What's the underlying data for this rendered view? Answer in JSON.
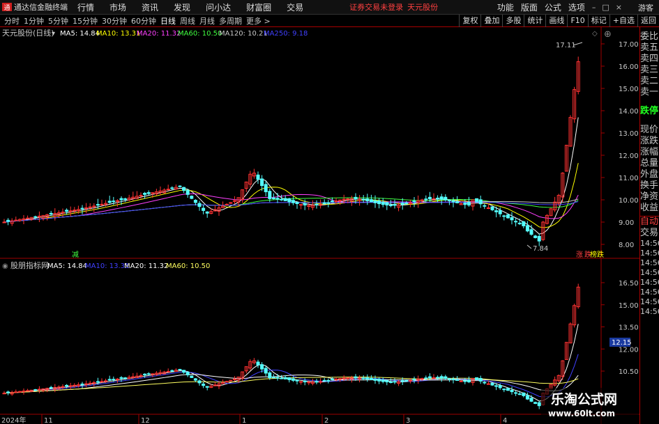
{
  "app": {
    "title": "通达信金融终端",
    "logo_glyph": "通",
    "menu": [
      "行情",
      "市场",
      "资讯",
      "发现",
      "问小达",
      "财富圈",
      "交易"
    ],
    "login_warning": "证券交易未登录",
    "top_stock_name": "天元股份",
    "right_menu": [
      "功能",
      "版面",
      "公式",
      "选项"
    ],
    "window_buttons": [
      "–",
      "□",
      "×"
    ],
    "guest": "游客"
  },
  "periods": {
    "tabs": [
      "分时",
      "1分钟",
      "5分钟",
      "15分钟",
      "30分钟",
      "60分钟",
      "日线",
      "周线",
      "月线",
      "多周期",
      "更多 >"
    ],
    "active": "日线"
  },
  "toolbar": [
    "复权",
    "叠加",
    "多股",
    "统计",
    "画线",
    "F10",
    "标记",
    "+自选",
    "返回"
  ],
  "upper_pane": {
    "stock_label": "天元股份(日线)",
    "ma_legend": [
      {
        "label": "MA5: 14.84",
        "color": "#ffffff"
      },
      {
        "label": "MA10: 13.31",
        "color": "#ffff00"
      },
      {
        "label": "MA20: 11.32",
        "color": "#ff40ff"
      },
      {
        "label": "MA60: 10.50",
        "color": "#40ff40"
      },
      {
        "label": "MA120: 10.21",
        "color": "#c8c8c8"
      },
      {
        "label": "MA250: 9.18",
        "color": "#4040ff"
      }
    ],
    "y_ticks": [
      "17.00",
      "16.00",
      "15.00",
      "14.00",
      "13.00",
      "12.00",
      "11.00",
      "10.00",
      "9.00",
      "8.00"
    ],
    "max_label": "17.11",
    "min_label": "7.84",
    "reduce_mark": "减",
    "limit_label_1": "涨",
    "limit_label_2": "跌",
    "limit_label_3": "榜跌"
  },
  "lower_pane": {
    "indicator_label": "股朋指标网",
    "ma_legend": [
      {
        "label": "MA5: 14.84",
        "color": "#ffffff"
      },
      {
        "label": "MA10: 13.31",
        "color": "#4040ff"
      },
      {
        "label": "MA20: 11.32",
        "color": "#ffffff"
      },
      {
        "label": "MA60: 10.50",
        "color": "#ffff60"
      }
    ],
    "y_ticks": [
      "16.50",
      "15.00",
      "13.50",
      "12.00",
      "10.50"
    ],
    "current_price": "12.15"
  },
  "x_axis": {
    "labels": [
      "2024年",
      "11",
      "12",
      "1",
      "2",
      "3",
      "4"
    ]
  },
  "side_panel": {
    "upper_items": [
      "委比",
      "卖五",
      "卖四",
      "卖三",
      "卖二",
      "卖一"
    ],
    "status": "跌停",
    "quote_items": [
      "现价",
      "涨跌",
      "涨幅",
      "总量",
      "外盘",
      "换手",
      "净资",
      "收益"
    ],
    "lower_items": [
      "自动",
      "交易"
    ],
    "times": [
      "14:56",
      "14:56",
      "14:56",
      "14:56",
      "14:56",
      "14:56",
      "14:56",
      "14:56"
    ]
  },
  "watermark": {
    "title": "乐淘公式网",
    "url": "www.60lt.com"
  },
  "colors": {
    "up": "#ff3232",
    "down": "#54ffff",
    "grid": "#a00000",
    "axis_text": "#c8c8c8"
  },
  "chart_data": {
    "type": "candlestick",
    "y_range": [
      7.6,
      17.3
    ],
    "x_labels": [
      "2024年",
      "11",
      "12",
      "1",
      "2",
      "3",
      "4"
    ],
    "max": 17.11,
    "min": 7.84,
    "ma_latest": {
      "MA5": 14.84,
      "MA10": 13.31,
      "MA20": 11.32,
      "MA60": 10.5,
      "MA120": 10.21,
      "MA250": 9.18
    }
  }
}
